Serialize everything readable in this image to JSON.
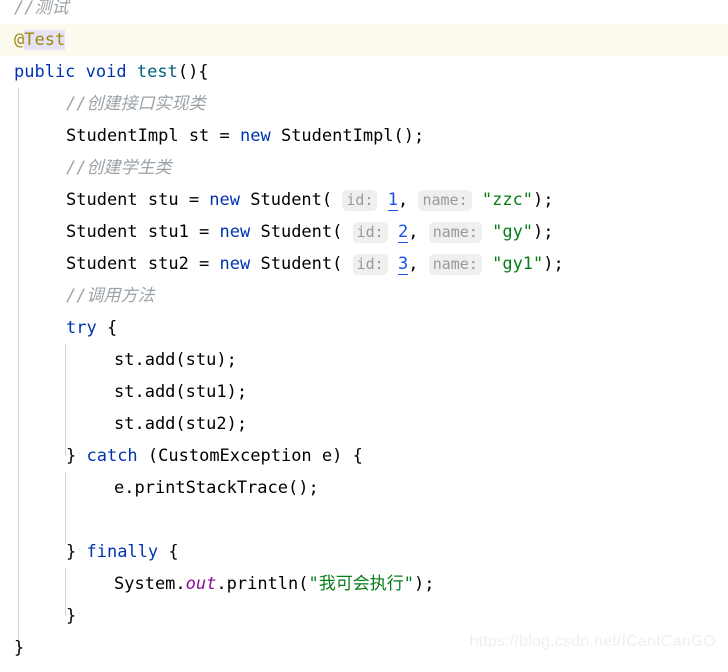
{
  "editor": {
    "language": "java",
    "background": "#ffffff",
    "current_line_highlight": "#fcfaef",
    "indent_guide_color": "#d5d5d5",
    "colors": {
      "keyword": "#0033b3",
      "comment": "#9ca3a8",
      "string": "#067d17",
      "number": "#1750eb",
      "annotation": "#9e880d",
      "method_declaration": "#00627a",
      "static_field": "#871094",
      "inlay_hint_text": "#9a9a9a",
      "inlay_hint_background": "#efefef",
      "plain_text": "#000000"
    }
  },
  "code": {
    "line01": {
      "comment": "//测试"
    },
    "line02": {
      "at": "@",
      "name": "Test"
    },
    "line03": {
      "kw1": "public",
      "sp1": " ",
      "kw2": "void",
      "sp2": " ",
      "method": "test",
      "tail": "(){"
    },
    "line04": {
      "comment": "//创建接口实现类"
    },
    "line05": {
      "pre": "StudentImpl st = ",
      "kw": "new",
      "post": " StudentImpl();"
    },
    "line06": {
      "comment": "//创建学生类"
    },
    "line07": {
      "pre": "Student stu = ",
      "kw": "new",
      "mid": " Student( ",
      "hint1": "id:",
      "num": "1",
      "sep": ", ",
      "hint2": "name:",
      "str": "\"zzc\"",
      "post": ");"
    },
    "line08": {
      "pre": "Student stu1 = ",
      "kw": "new",
      "mid": " Student( ",
      "hint1": "id:",
      "num": "2",
      "sep": ", ",
      "hint2": "name:",
      "str": "\"gy\"",
      "post": ");"
    },
    "line09": {
      "pre": "Student stu2 = ",
      "kw": "new",
      "mid": " Student( ",
      "hint1": "id:",
      "num": "3",
      "sep": ", ",
      "hint2": "name:",
      "str": "\"gy1\"",
      "post": ");"
    },
    "line10": {
      "comment": "//调用方法"
    },
    "line11": {
      "kw": "try",
      "post": " {"
    },
    "line12": {
      "text": "st.add(stu);"
    },
    "line13": {
      "text": "st.add(stu1);"
    },
    "line14": {
      "text": "st.add(stu2);"
    },
    "line15": {
      "pre": "} ",
      "kw": "catch",
      "post": " (CustomException e) {"
    },
    "line16": {
      "text": "e.printStackTrace();"
    },
    "line17": {
      "text": ""
    },
    "line18": {
      "pre": "} ",
      "kw": "finally",
      "post": " {"
    },
    "line19": {
      "pre": "System.",
      "field": "out",
      "mid": ".println(",
      "str": "\"我可会执行\"",
      "post": ");"
    },
    "line20": {
      "text": "}"
    },
    "line21": {
      "text": "}"
    }
  },
  "watermark": {
    "text": "https://blog.csdn.net/ICanICanGO"
  }
}
